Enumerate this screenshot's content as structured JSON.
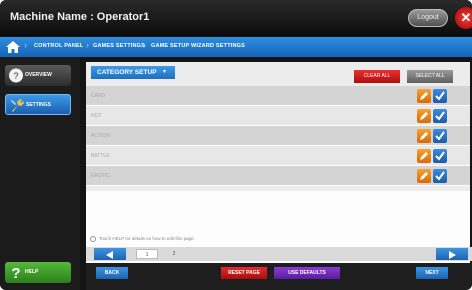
{
  "header": {
    "title": "Machine Name : Operator1",
    "logout_label": "Logout",
    "close_label": "✕"
  },
  "breadcrumb": [
    "CONTROL PANEL",
    "GAMES SETTINGS",
    "GAME SETUP WIZARD SETTINGS"
  ],
  "sidebar": {
    "items": [
      {
        "label": "OVERVIEW",
        "icon": "overview-icon"
      },
      {
        "label": "SETTINGS",
        "icon": "wrench-icon"
      }
    ],
    "help_label": "HELP"
  },
  "toolbar": {
    "category_dropdown": "CATEGORY SETUP",
    "clear_all": "CLEAR ALL",
    "select_all": "SELECT ALL"
  },
  "categories": [
    {
      "label": "CARD"
    },
    {
      "label": "HOT"
    },
    {
      "label": "ACTION"
    },
    {
      "label": "BATTLE"
    },
    {
      "label": "EROTIC"
    }
  ],
  "hint_text": "Touch HELP for details on how to edit this page.",
  "pagination": {
    "pages": [
      "1",
      "2"
    ],
    "active_page": "1"
  },
  "footer": {
    "back": "BACK",
    "reset_page": "RESET PAGE",
    "use_defaults": "USE DEFAULTS",
    "next": "NEXT"
  },
  "colors": {
    "accent_blue": "#1f6fbd",
    "danger_red": "#c81a1a",
    "defaults_purple": "#6b28b5",
    "help_green": "#3f9f2a",
    "edit_orange": "#e87f12"
  }
}
